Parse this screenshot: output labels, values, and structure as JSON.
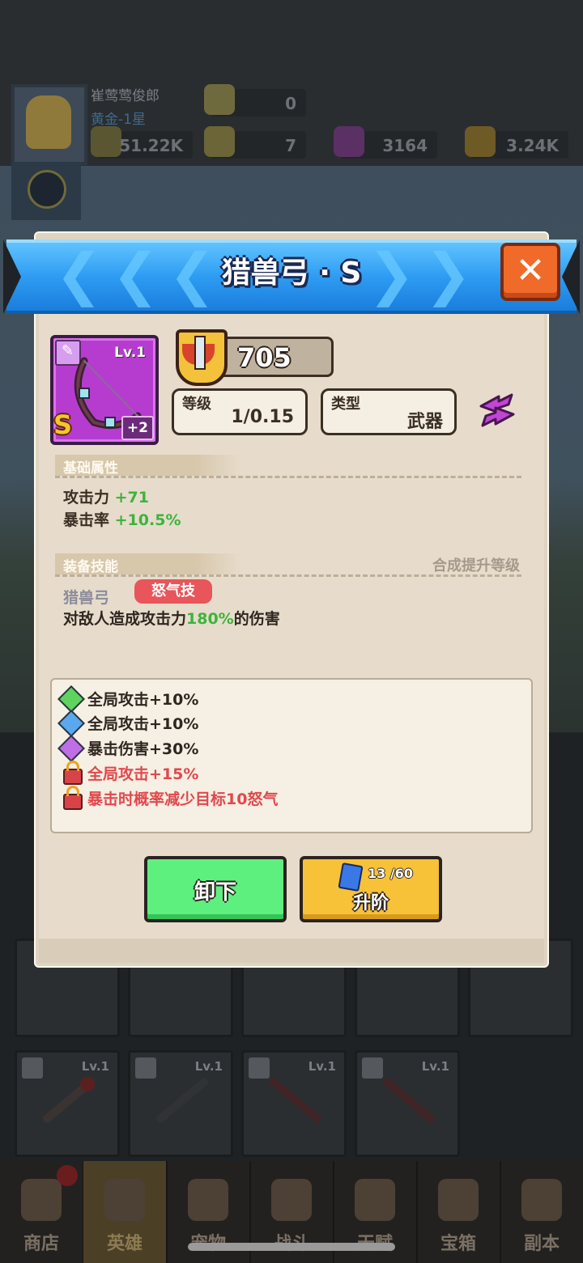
{
  "background": {
    "player_name": "崔莺莺俊郎",
    "player_rank": "黄金-1星",
    "resources": [
      "0",
      "51.22K",
      "7",
      "3164",
      "3.24K"
    ],
    "slot_level": "Lv.1",
    "nav": [
      "商店",
      "英雄",
      "宠物",
      "战斗",
      "天赋",
      "宝箱",
      "副本"
    ]
  },
  "modal": {
    "title": "猎兽弓 · S",
    "close_icon": "✕",
    "item": {
      "level": "Lv.1",
      "grade": "S",
      "plus": "+2",
      "rarity_color": "#b63cd0"
    },
    "power": "705",
    "level_label": "等级",
    "level_value": "1/0.15",
    "type_label": "类型",
    "type_value": "武器",
    "base_attr_title": "基础属性",
    "attributes": [
      {
        "name": "攻击力",
        "value": "+71"
      },
      {
        "name": "暴击率",
        "value": "+10.5%"
      }
    ],
    "skill_title": "装备技能",
    "synth_hint": "合成提升等级",
    "skill": {
      "name": "猎兽弓",
      "tag": "怒气技",
      "desc_prefix": "对敌人造成攻击力",
      "desc_value": "180%",
      "desc_suffix": "的伤害"
    },
    "buffs": [
      {
        "text": "全局攻击+10%",
        "icon": "green-gem-icon",
        "color": "#5fd35f",
        "locked": false
      },
      {
        "text": "全局攻击+10%",
        "icon": "blue-gem-icon",
        "color": "#5aa8f0",
        "locked": false
      },
      {
        "text": "暴击伤害+30%",
        "icon": "purple-gem-icon",
        "color": "#c06ee6",
        "locked": false
      },
      {
        "text": "全局攻击+15%",
        "icon": "lock-icon",
        "color": "#e0484d",
        "locked": true
      },
      {
        "text": "暴击时概率减少目标10怒气",
        "icon": "lock-icon",
        "color": "#e0484d",
        "locked": true
      }
    ],
    "unequip_label": "卸下",
    "upgrade_label": "升阶",
    "upgrade_count": "13 /60"
  }
}
